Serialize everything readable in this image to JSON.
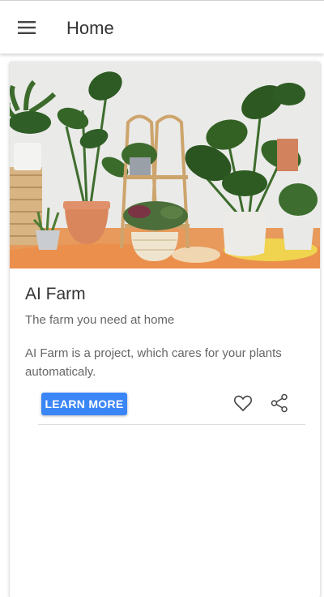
{
  "app_bar": {
    "title": "Home",
    "menu_icon": "hamburger-menu-icon"
  },
  "card": {
    "image_alt": "Assorted potted house plants on wooden stands",
    "title": "AI Farm",
    "subtitle": "The farm you need at home",
    "body": "AI Farm is a project, which cares for your plants automaticaly.",
    "action_label": "LEARN MORE",
    "favorite_icon": "heart-icon",
    "share_icon": "share-icon"
  },
  "colors": {
    "accent": "#3b86f7",
    "title_text": "#333333",
    "secondary_text": "#666666"
  }
}
